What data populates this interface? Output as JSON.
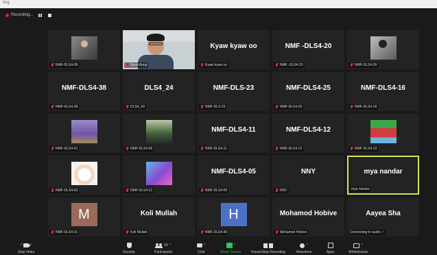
{
  "window": {
    "title": "ting"
  },
  "recording": {
    "label": "Recording..."
  },
  "tiles": [
    {
      "label": "NMF-DLS4-08",
      "thumb": "photo1",
      "muted": true
    },
    {
      "label": "Sann Aung",
      "video": true,
      "muted": true
    },
    {
      "label": "Kyaw kyaw oo",
      "name": "Kyaw kyaw oo",
      "muted": true
    },
    {
      "label": "NMF -DLS4-20",
      "name": "NMF -DLS4-20",
      "muted": true
    },
    {
      "label": "NMF-DLS4-30",
      "thumb": "photo2",
      "muted": true
    },
    {
      "label": "NMF-DLS4-38",
      "name": "NMF-DLS4-38",
      "muted": true
    },
    {
      "label": "DLS4_24",
      "name": "DLS4_24",
      "muted": true
    },
    {
      "label": "NMF-DLS-23",
      "name": "NMF-DLS-23",
      "muted": true
    },
    {
      "label": "NMF-DLS4-25",
      "name": "NMF-DLS4-25",
      "muted": true
    },
    {
      "label": "NMF-DLS4-16",
      "name": "NMF-DLS4-16",
      "muted": true
    },
    {
      "label": "NMF-DLS4-41",
      "thumb": "lavender",
      "muted": true
    },
    {
      "label": "NMF-DLS4-06",
      "thumb": "forest",
      "muted": true
    },
    {
      "label": "NMF-DLS4-11",
      "name": "NMF-DLS4-11",
      "muted": true
    },
    {
      "label": "NMF-DLS4-12",
      "name": "NMF-DLS4-12",
      "muted": true
    },
    {
      "label": "NMF-DLS4-13",
      "thumb": "track",
      "muted": true
    },
    {
      "label": "NMF-DLS4-03",
      "thumb": "dog",
      "muted": true
    },
    {
      "label": "NMF-DLS4-21",
      "thumb": "abstract",
      "muted": true
    },
    {
      "label": "NMF-DLS4-05",
      "name": "NMF-DLS4-05",
      "muted": true
    },
    {
      "label": "NNY",
      "name": "NNY",
      "muted": true
    },
    {
      "label": "mya nandar",
      "name": "mya nandar",
      "muted": false,
      "active": true
    },
    {
      "label": "NMF-DLS4-31",
      "avatar": "M",
      "avatarColor": "#9a6a5a",
      "muted": true
    },
    {
      "label": "Koli Mullah",
      "name": "Koli Mullah",
      "muted": true
    },
    {
      "label": "NMF-DLS4-30",
      "avatar": "H",
      "avatarColor": "#4b72c6",
      "muted": true
    },
    {
      "label": "Mohamod Hobive",
      "name": "Mohamod Hobive",
      "muted": true
    },
    {
      "label": "Connecting to audio ✓",
      "name": "Aayea Sha",
      "muted": false
    }
  ],
  "toolbar": {
    "stop_video": "Stop Video",
    "security": "Security",
    "participants": "Participants",
    "participants_count": "25",
    "chat": "Chat",
    "share_screen": "Share Screen",
    "pause_recording": "Pause/Stop Recording",
    "reactions": "Reactions",
    "apps": "Apps",
    "whiteboards": "Whiteboards"
  }
}
